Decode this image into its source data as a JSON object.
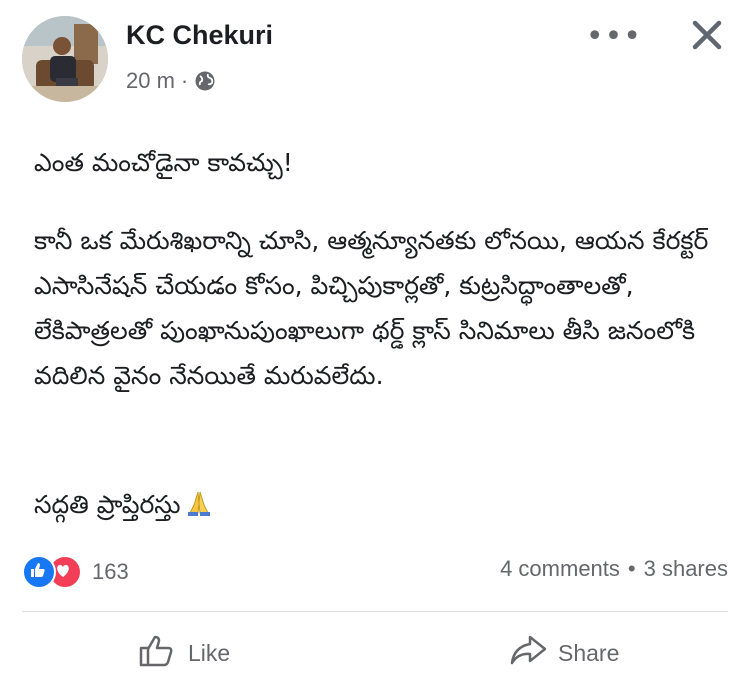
{
  "post": {
    "author": "KC Chekuri",
    "time": "20 m",
    "separator": "·",
    "audience_icon": "globe-icon",
    "paragraphs": [
      "ఎంత మంచోడైనా కావచ్చు!",
      "కానీ ఒక మేరుశిఖరాన్ని చూసి, ఆత్మన్యూనతకు లోనయి, ఆయన కేరక్టర్ ఎసాసినేషన్ చేయడం కోసం, పిచ్చిపుకార్లతో, కుట్రసిద్ధాంతాలతో, లేకిపాత్రలతో  పుంఖానుపుంఖాలుగా థర్డ్ క్లాస్ సినిమాలు తీసి జనంలోకి వదిలిన వైనం నేనయితే మరువలేదు.",
      "సద్గతి ప్రాప్తిరస్తు"
    ],
    "closing_emoji": "folded-hands-emoji"
  },
  "engagement": {
    "reaction_count": "163",
    "comments": "4 comments",
    "dot": "•",
    "shares": "3 shares"
  },
  "actions": {
    "like_label": "Like",
    "share_label": "Share"
  },
  "colors": {
    "like_blue": "#1877f2",
    "love_red": "#f33e58",
    "secondary_text": "#65676b"
  }
}
